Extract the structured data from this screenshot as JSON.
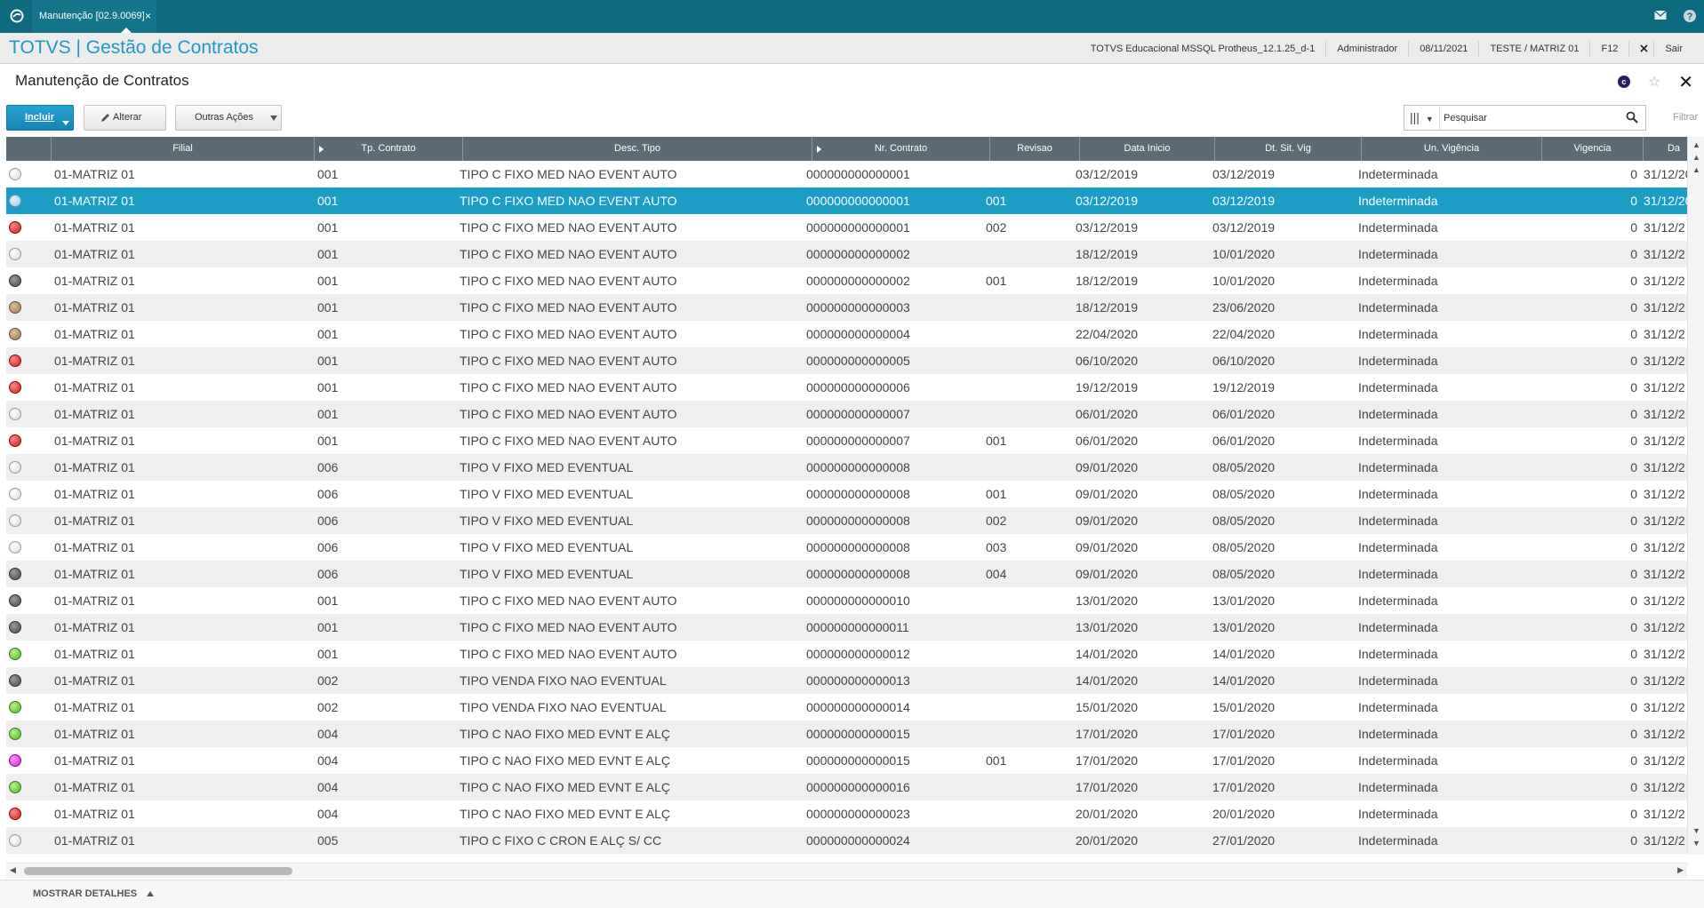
{
  "topbar": {
    "tab_label": "Manutenção [02.9.0069]",
    "tab_close": "×"
  },
  "header": {
    "brand": "TOTVS | Gestão de Contratos",
    "environment": "TOTVS Educacional MSSQL Protheus_12.1.25_d-1",
    "user": "Administrador",
    "date": "08/11/2021",
    "branch": "TESTE / MATRIZ 01",
    "shortcut": "F12",
    "logout": "Sair"
  },
  "page": {
    "title": "Manutenção de Contratos"
  },
  "toolbar": {
    "incluir": "Incluir",
    "alterar": "Alterar",
    "outras": "Outras Ações",
    "search_placeholder": "Pesquisar",
    "filter": "Filtrar"
  },
  "grid": {
    "columns": [
      "Filial",
      "Tp. Contrato",
      "Desc. Tipo",
      "Nr. Contrato",
      "Revisao",
      "Data Inicio",
      "Dt. Sit. Vig",
      "Un. Vigência",
      "Vigencia",
      "Da"
    ],
    "selected_row": 1,
    "rows": [
      {
        "status": "white",
        "filial": "01-MATRIZ 01",
        "tp": "001",
        "desc": "TIPO C FIXO MED NAO EVENT AUTO",
        "nr": "000000000000001",
        "rev": "",
        "inicio": "03/12/2019",
        "sitvig": "03/12/2019",
        "unvig": "Indeterminada",
        "vig": "0",
        "da": "31/12/20"
      },
      {
        "status": "lightblue",
        "filial": "01-MATRIZ 01",
        "tp": "001",
        "desc": "TIPO C FIXO MED NAO EVENT AUTO",
        "nr": "000000000000001",
        "rev": "001",
        "inicio": "03/12/2019",
        "sitvig": "03/12/2019",
        "unvig": "Indeterminada",
        "vig": "0",
        "da": "31/12/20"
      },
      {
        "status": "red",
        "filial": "01-MATRIZ 01",
        "tp": "001",
        "desc": "TIPO C FIXO MED NAO EVENT AUTO",
        "nr": "000000000000001",
        "rev": "002",
        "inicio": "03/12/2019",
        "sitvig": "03/12/2019",
        "unvig": "Indeterminada",
        "vig": "0",
        "da": "31/12/2"
      },
      {
        "status": "white",
        "filial": "01-MATRIZ 01",
        "tp": "001",
        "desc": "TIPO C FIXO MED NAO EVENT AUTO",
        "nr": "000000000000002",
        "rev": "",
        "inicio": "18/12/2019",
        "sitvig": "10/01/2020",
        "unvig": "Indeterminada",
        "vig": "0",
        "da": "31/12/2"
      },
      {
        "status": "gray",
        "filial": "01-MATRIZ 01",
        "tp": "001",
        "desc": "TIPO C FIXO MED NAO EVENT AUTO",
        "nr": "000000000000002",
        "rev": "001",
        "inicio": "18/12/2019",
        "sitvig": "10/01/2020",
        "unvig": "Indeterminada",
        "vig": "0",
        "da": "31/12/2"
      },
      {
        "status": "tan",
        "filial": "01-MATRIZ 01",
        "tp": "001",
        "desc": "TIPO C FIXO MED NAO EVENT AUTO",
        "nr": "000000000000003",
        "rev": "",
        "inicio": "18/12/2019",
        "sitvig": "23/06/2020",
        "unvig": "Indeterminada",
        "vig": "0",
        "da": "31/12/2"
      },
      {
        "status": "tan",
        "filial": "01-MATRIZ 01",
        "tp": "001",
        "desc": "TIPO C FIXO MED NAO EVENT AUTO",
        "nr": "000000000000004",
        "rev": "",
        "inicio": "22/04/2020",
        "sitvig": "22/04/2020",
        "unvig": "Indeterminada",
        "vig": "0",
        "da": "31/12/2"
      },
      {
        "status": "red",
        "filial": "01-MATRIZ 01",
        "tp": "001",
        "desc": "TIPO C FIXO MED NAO EVENT AUTO",
        "nr": "000000000000005",
        "rev": "",
        "inicio": "06/10/2020",
        "sitvig": "06/10/2020",
        "unvig": "Indeterminada",
        "vig": "0",
        "da": "31/12/2"
      },
      {
        "status": "red",
        "filial": "01-MATRIZ 01",
        "tp": "001",
        "desc": "TIPO C FIXO MED NAO EVENT AUTO",
        "nr": "000000000000006",
        "rev": "",
        "inicio": "19/12/2019",
        "sitvig": "19/12/2019",
        "unvig": "Indeterminada",
        "vig": "0",
        "da": "31/12/2"
      },
      {
        "status": "white",
        "filial": "01-MATRIZ 01",
        "tp": "001",
        "desc": "TIPO C FIXO MED NAO EVENT AUTO",
        "nr": "000000000000007",
        "rev": "",
        "inicio": "06/01/2020",
        "sitvig": "06/01/2020",
        "unvig": "Indeterminada",
        "vig": "0",
        "da": "31/12/2"
      },
      {
        "status": "red",
        "filial": "01-MATRIZ 01",
        "tp": "001",
        "desc": "TIPO C FIXO MED NAO EVENT AUTO",
        "nr": "000000000000007",
        "rev": "001",
        "inicio": "06/01/2020",
        "sitvig": "06/01/2020",
        "unvig": "Indeterminada",
        "vig": "0",
        "da": "31/12/2"
      },
      {
        "status": "white",
        "filial": "01-MATRIZ 01",
        "tp": "006",
        "desc": "TIPO V FIXO MED EVENTUAL",
        "nr": "000000000000008",
        "rev": "",
        "inicio": "09/01/2020",
        "sitvig": "08/05/2020",
        "unvig": "Indeterminada",
        "vig": "0",
        "da": "31/12/2"
      },
      {
        "status": "white",
        "filial": "01-MATRIZ 01",
        "tp": "006",
        "desc": "TIPO V FIXO MED EVENTUAL",
        "nr": "000000000000008",
        "rev": "001",
        "inicio": "09/01/2020",
        "sitvig": "08/05/2020",
        "unvig": "Indeterminada",
        "vig": "0",
        "da": "31/12/2"
      },
      {
        "status": "white",
        "filial": "01-MATRIZ 01",
        "tp": "006",
        "desc": "TIPO V FIXO MED EVENTUAL",
        "nr": "000000000000008",
        "rev": "002",
        "inicio": "09/01/2020",
        "sitvig": "08/05/2020",
        "unvig": "Indeterminada",
        "vig": "0",
        "da": "31/12/2"
      },
      {
        "status": "white",
        "filial": "01-MATRIZ 01",
        "tp": "006",
        "desc": "TIPO V FIXO MED EVENTUAL",
        "nr": "000000000000008",
        "rev": "003",
        "inicio": "09/01/2020",
        "sitvig": "08/05/2020",
        "unvig": "Indeterminada",
        "vig": "0",
        "da": "31/12/2"
      },
      {
        "status": "gray",
        "filial": "01-MATRIZ 01",
        "tp": "006",
        "desc": "TIPO V FIXO MED EVENTUAL",
        "nr": "000000000000008",
        "rev": "004",
        "inicio": "09/01/2020",
        "sitvig": "08/05/2020",
        "unvig": "Indeterminada",
        "vig": "0",
        "da": "31/12/2"
      },
      {
        "status": "gray",
        "filial": "01-MATRIZ 01",
        "tp": "001",
        "desc": "TIPO C FIXO MED NAO EVENT AUTO",
        "nr": "000000000000010",
        "rev": "",
        "inicio": "13/01/2020",
        "sitvig": "13/01/2020",
        "unvig": "Indeterminada",
        "vig": "0",
        "da": "31/12/2"
      },
      {
        "status": "gray",
        "filial": "01-MATRIZ 01",
        "tp": "001",
        "desc": "TIPO C FIXO MED NAO EVENT AUTO",
        "nr": "000000000000011",
        "rev": "",
        "inicio": "13/01/2020",
        "sitvig": "13/01/2020",
        "unvig": "Indeterminada",
        "vig": "0",
        "da": "31/12/2"
      },
      {
        "status": "green",
        "filial": "01-MATRIZ 01",
        "tp": "001",
        "desc": "TIPO C FIXO MED NAO EVENT AUTO",
        "nr": "000000000000012",
        "rev": "",
        "inicio": "14/01/2020",
        "sitvig": "14/01/2020",
        "unvig": "Indeterminada",
        "vig": "0",
        "da": "31/12/2"
      },
      {
        "status": "gray",
        "filial": "01-MATRIZ 01",
        "tp": "002",
        "desc": "TIPO VENDA FIXO NAO EVENTUAL",
        "nr": "000000000000013",
        "rev": "",
        "inicio": "14/01/2020",
        "sitvig": "14/01/2020",
        "unvig": "Indeterminada",
        "vig": "0",
        "da": "31/12/2"
      },
      {
        "status": "green",
        "filial": "01-MATRIZ 01",
        "tp": "002",
        "desc": "TIPO VENDA FIXO NAO EVENTUAL",
        "nr": "000000000000014",
        "rev": "",
        "inicio": "15/01/2020",
        "sitvig": "15/01/2020",
        "unvig": "Indeterminada",
        "vig": "0",
        "da": "31/12/2"
      },
      {
        "status": "green",
        "filial": "01-MATRIZ 01",
        "tp": "004",
        "desc": "TIPO C NAO FIXO MED EVNT E ALÇ",
        "nr": "000000000000015",
        "rev": "",
        "inicio": "17/01/2020",
        "sitvig": "17/01/2020",
        "unvig": "Indeterminada",
        "vig": "0",
        "da": "31/12/2"
      },
      {
        "status": "pink",
        "filial": "01-MATRIZ 01",
        "tp": "004",
        "desc": "TIPO C NAO FIXO MED EVNT E ALÇ",
        "nr": "000000000000015",
        "rev": "001",
        "inicio": "17/01/2020",
        "sitvig": "17/01/2020",
        "unvig": "Indeterminada",
        "vig": "0",
        "da": "31/12/2"
      },
      {
        "status": "green",
        "filial": "01-MATRIZ 01",
        "tp": "004",
        "desc": "TIPO C NAO FIXO MED EVNT E ALÇ",
        "nr": "000000000000016",
        "rev": "",
        "inicio": "17/01/2020",
        "sitvig": "17/01/2020",
        "unvig": "Indeterminada",
        "vig": "0",
        "da": "31/12/2"
      },
      {
        "status": "red",
        "filial": "01-MATRIZ 01",
        "tp": "004",
        "desc": "TIPO C NAO FIXO MED EVNT E ALÇ",
        "nr": "000000000000023",
        "rev": "",
        "inicio": "20/01/2020",
        "sitvig": "20/01/2020",
        "unvig": "Indeterminada",
        "vig": "0",
        "da": "31/12/2"
      },
      {
        "status": "white",
        "filial": "01-MATRIZ 01",
        "tp": "005",
        "desc": "TIPO C FIXO C CRON E ALÇ S/ CC",
        "nr": "000000000000024",
        "rev": "",
        "inicio": "20/01/2020",
        "sitvig": "27/01/2020",
        "unvig": "Indeterminada",
        "vig": "0",
        "da": "31/12/2"
      }
    ]
  },
  "footer": {
    "details": "MOSTRAR DETALHES"
  }
}
